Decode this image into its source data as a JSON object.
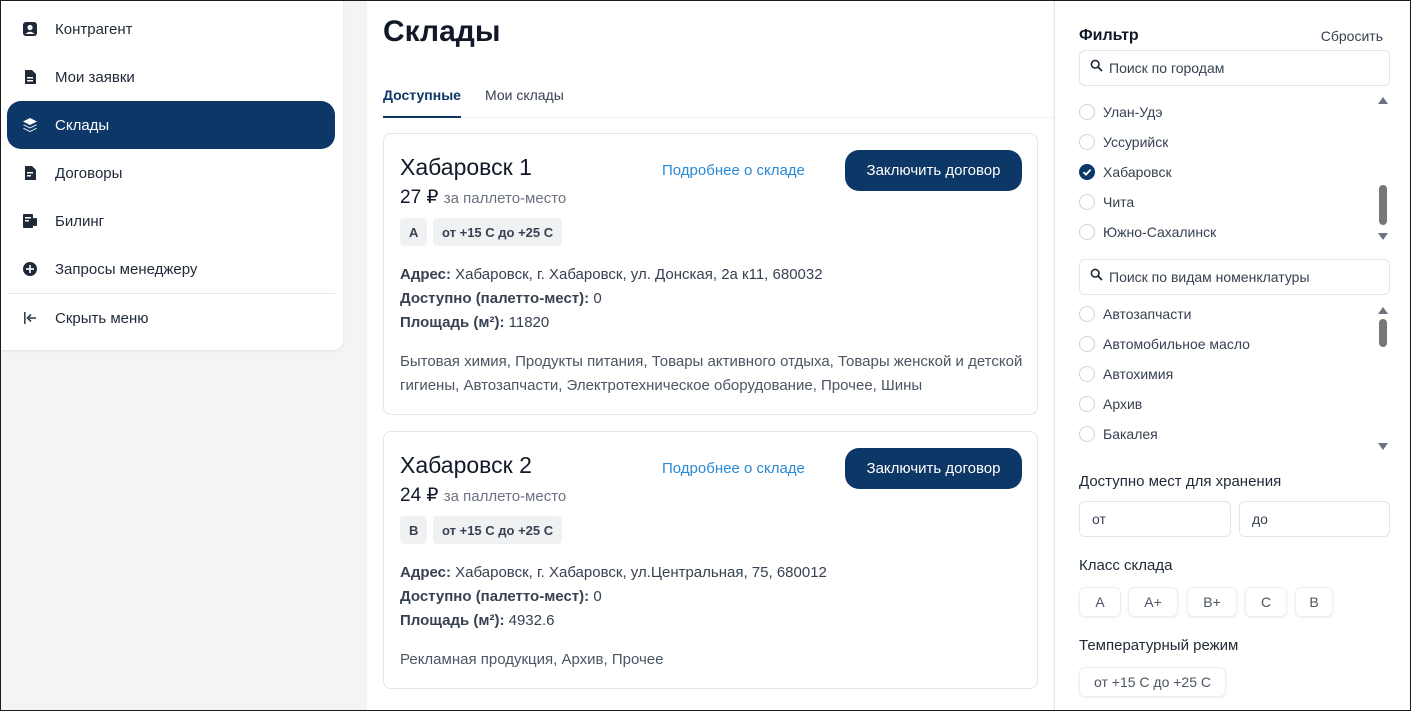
{
  "sidebar": {
    "items": [
      {
        "label": "Контрагент",
        "icon": "user-square-icon"
      },
      {
        "label": "Мои заявки",
        "icon": "document-icon"
      },
      {
        "label": "Склады",
        "icon": "layers-icon"
      },
      {
        "label": "Договоры",
        "icon": "contract-icon"
      },
      {
        "label": "Билинг",
        "icon": "billing-icon"
      },
      {
        "label": "Запросы менеджеру",
        "icon": "plus-circle-icon"
      }
    ],
    "active_index": 2,
    "hide_menu": {
      "label": "Скрыть меню",
      "icon": "collapse-left-icon"
    }
  },
  "main": {
    "title": "Склады",
    "tabs": [
      {
        "label": "Доступные",
        "active": true
      },
      {
        "label": "Мои склады",
        "active": false
      }
    ],
    "cards": [
      {
        "name": "Хабаровск 1",
        "price": "27 ₽",
        "price_unit": "за паллето-место",
        "class_badge": "А",
        "temp_badge": "от +15 С до +25 С",
        "details_link": "Подробнее о складе",
        "contract_button": "Заключить договор",
        "address_label": "Адрес:",
        "address": "Хабаровск, г. Хабаровск, ул. Донская, 2а к11, 680032",
        "available_label": "Доступно (палетто-мест):",
        "available": "0",
        "area_label": "Площадь (м²):",
        "area": "11820",
        "categories": "Бытовая химия, Продукты питания, Товары активного отдыха, Товары женской и детской гигиены, Автозапчасти, Электротехническое оборудование, Прочее, Шины"
      },
      {
        "name": "Хабаровск 2",
        "price": "24 ₽",
        "price_unit": "за паллето-место",
        "class_badge": "В",
        "temp_badge": "от +15 С до +25 С",
        "details_link": "Подробнее о складе",
        "contract_button": "Заключить договор",
        "address_label": "Адрес:",
        "address": "Хабаровск, г. Хабаровск, ул.Центральная, 75, 680012",
        "available_label": "Доступно (палетто-мест):",
        "available": "0",
        "area_label": "Площадь (м²):",
        "area": "4932.6",
        "categories": "Рекламная продукция, Архив, Прочее"
      }
    ]
  },
  "filter": {
    "title": "Фильтр",
    "reset": "Сбросить",
    "city_search_placeholder": "Поиск по городам",
    "cities": [
      {
        "label": "Улан-Удэ",
        "checked": false
      },
      {
        "label": "Уссурийск",
        "checked": false
      },
      {
        "label": "Хабаровск",
        "checked": true
      },
      {
        "label": "Чита",
        "checked": false
      },
      {
        "label": "Южно-Сахалинск",
        "checked": false
      }
    ],
    "nomenclature_search_placeholder": "Поиск по видам номенклатуры",
    "nomenclature": [
      {
        "label": "Автозапчасти",
        "checked": false
      },
      {
        "label": "Автомобильное масло",
        "checked": false
      },
      {
        "label": "Автохимия",
        "checked": false
      },
      {
        "label": "Архив",
        "checked": false
      },
      {
        "label": "Бакалея",
        "checked": false
      }
    ],
    "storage_label": "Доступно мест для хранения",
    "from_placeholder": "от",
    "to_placeholder": "до",
    "class_label": "Класс склада",
    "classes": [
      "А",
      "А+",
      "В+",
      "С",
      "В"
    ],
    "temp_label": "Температурный режим",
    "temps": [
      "от +15 С до +25 С"
    ]
  },
  "colors": {
    "accent": "#0c3766",
    "link": "#2a8ad6"
  }
}
